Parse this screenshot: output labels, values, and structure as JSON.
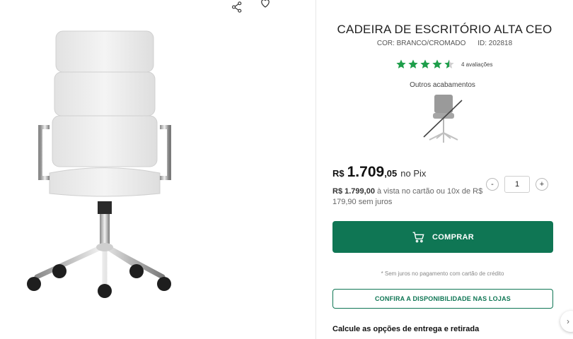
{
  "gallery": {
    "share_icon": "share-icon",
    "favorite_icon": "heart-icon"
  },
  "product": {
    "title": "CADEIRA DE ESCRITÓRIO ALTA CEO",
    "color": "COR: BRANCO/CROMADO",
    "id": "ID: 202818",
    "rating_stars": 4.5,
    "rating_count": "4 avaliações",
    "finishes_label": "Outros acabamentos"
  },
  "price": {
    "currency": "R$",
    "integer": "1.709",
    "cents": ",05",
    "method": "no Pix",
    "card_price": "R$ 1.799,00",
    "card_text": "à vista no cartão ou 10x de R$ 179,90 sem juros"
  },
  "quantity": {
    "minus": "-",
    "value": "1",
    "plus": "+"
  },
  "actions": {
    "buy_label": "COMPRAR",
    "note": "* Sem juros no pagamento com cartão de crédito",
    "stock_label": "CONFIRA A DISPONIBILIDADE NAS LOJAS",
    "delivery_title": "Calcule as opções de entrega e retirada"
  },
  "colors": {
    "brand_green": "#0f7654",
    "star_green": "#1e9e4a"
  }
}
